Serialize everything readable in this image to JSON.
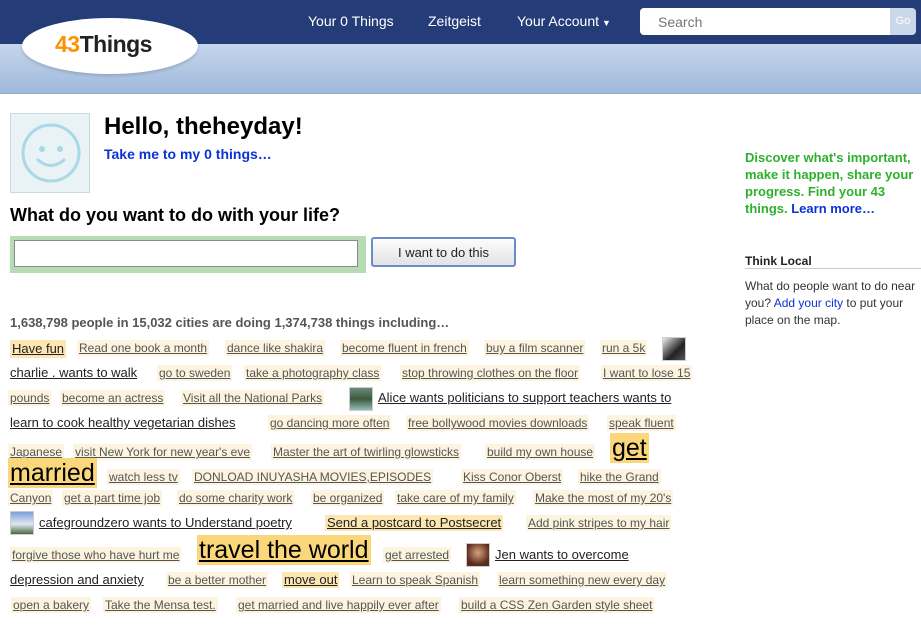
{
  "header": {
    "logo_num": "43",
    "logo_word": "Things",
    "nav": {
      "your_things": "Your 0 Things",
      "zeitgeist": "Zeitgeist",
      "your_account": "Your Account"
    },
    "search_placeholder": "Search",
    "search_go": "Go"
  },
  "main": {
    "greeting": "Hello, theheyday!",
    "take_me": "Take me to my 0 things…",
    "question": "What do you want to do with your life?",
    "submit_label": "I want to do this",
    "stats": "1,638,798 people in 15,032 cities are doing 1,374,738 things including…"
  },
  "cloud": {
    "have_fun": "Have fun",
    "read_book": "Read one book a month",
    "dance_shakira": "dance like shakira",
    "fluent_french": "become fluent in french",
    "film_scanner": "buy a film scanner",
    "run_5k": "run a 5k",
    "charlie": "charlie . wants to walk",
    "sweden": "go to sweden",
    "photo_class": "take a photography class",
    "clothes_floor": "stop throwing clothes on the floor",
    "lose_15a": "I want to lose 15",
    "lose_15b": "pounds",
    "actress": "become an actress",
    "nat_parks": "Visit all the National Parks",
    "alice": "Alice wants politicians to support teachers wants to",
    "cook_veg": "learn to cook healthy vegetarian dishes",
    "dancing_often": "go dancing more often",
    "bollywood": "free bollywood movies downloads",
    "speak_fluent_a": "speak fluent",
    "speak_fluent_b": "Japanese",
    "ny_eve": "visit New York for new year's eve",
    "glowsticks": "Master the art of twirling glowsticks",
    "own_house": "build my own house",
    "get_married_a": "get",
    "get_married_b": "married",
    "watch_tv": "watch less tv",
    "inuyasha": "DONLOAD INUYASHA MOVIES,EPISODES",
    "kiss_conor": "Kiss Conor Oberst",
    "hike_a": "hike the Grand",
    "hike_b": "Canyon",
    "part_time": "get a part time job",
    "charity": "do some charity work",
    "organized": "be organized",
    "family": "take care of my family",
    "most_20s": "Make the most of my 20's",
    "cafeground": "cafegroundzero wants to Understand poetry",
    "postcard": "Send a postcard to Postsecret",
    "pink_stripes": "Add pink stripes to my hair",
    "forgive": "forgive those who have hurt me",
    "travel": "travel the world",
    "arrested": "get arrested",
    "jen_a": "Jen wants to overcome",
    "jen_b": "depression and anxiety",
    "better_mother": "be a better mother",
    "move_out": "move out",
    "spanish": "Learn to speak Spanish",
    "new_every_day": "learn something new every day",
    "bakery": "open a bakery",
    "mensa": "Take the Mensa test.",
    "married_happily": "get married and live happily ever after",
    "zen_garden": "build a CSS Zen Garden style sheet"
  },
  "sidebar": {
    "promo": "Discover what's important, make it happen, share your progress. Find your 43 things.",
    "learn_more": "Learn more…",
    "think_local_title": "Think Local",
    "think_local_text_1": "What do people want to do near",
    "think_local_text_2": "you?",
    "add_city": "Add your city",
    "think_local_text_3": "to put your place on the map."
  },
  "colors": {
    "header_bg": "#243d79",
    "logo_accent": "#ff9200",
    "link_blue": "#0b32d6",
    "promo_green": "#2db12d",
    "tag_bg": "#fdf4df",
    "tag_big_bg": "#fad77a"
  }
}
